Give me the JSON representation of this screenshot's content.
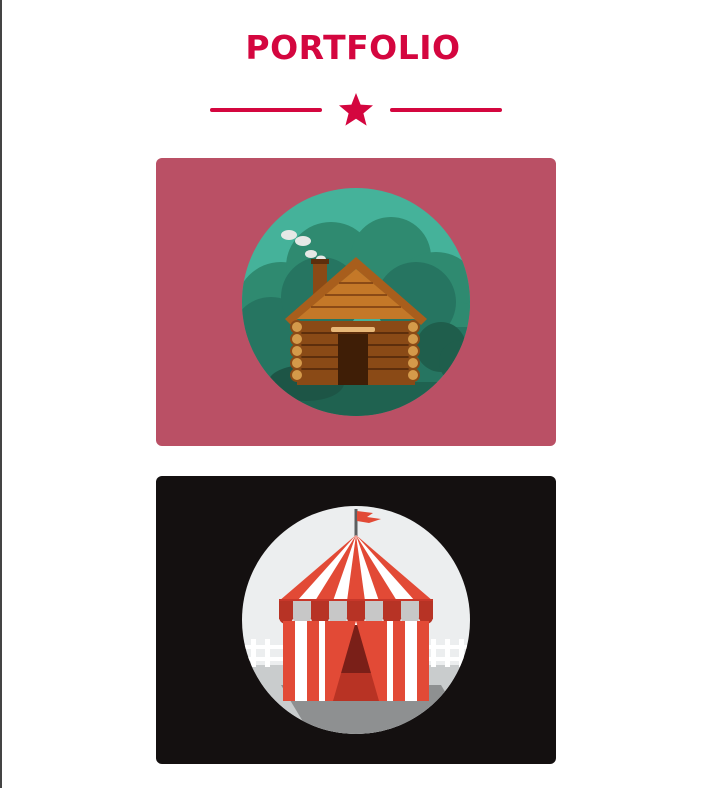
{
  "section": {
    "title": "PORTFOLIO",
    "divider_icon": "star-icon",
    "accent_color": "#d4063f"
  },
  "portfolio": {
    "items": [
      {
        "name": "cabin",
        "icon": "log-cabin-illustration",
        "background": "#ba5065"
      },
      {
        "name": "circus",
        "icon": "circus-tent-illustration",
        "background": "#141010"
      }
    ]
  }
}
